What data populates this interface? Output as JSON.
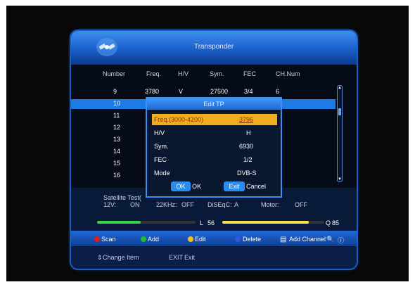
{
  "header": {
    "title": "Transponder"
  },
  "columns": [
    "Number",
    "Freq.",
    "H/V",
    "Sym.",
    "FEC",
    "CH.Num"
  ],
  "rows": [
    {
      "number": "9",
      "freq": "3780",
      "hv": "V",
      "sym": "27500",
      "fec": "3/4",
      "chnum": "6"
    },
    {
      "number": "10"
    },
    {
      "number": "11"
    },
    {
      "number": "12"
    },
    {
      "number": "13"
    },
    {
      "number": "14"
    },
    {
      "number": "15"
    },
    {
      "number": "16"
    }
  ],
  "selected_row": 1,
  "info": {
    "satellite": "Satellite Test(",
    "v12_label": "12V:",
    "v12_value": "ON",
    "k22_label": "22KHz:",
    "k22_value": "OFF",
    "diseqc_label": "DiSEqC:",
    "diseqc_value": "A",
    "motor_label": "Motor:",
    "motor_value": "OFF"
  },
  "signal": {
    "level_label": "L",
    "level_value": "56",
    "quality_label": "Q",
    "quality_value": "85",
    "level_percent": 56,
    "quality_percent": 85
  },
  "dialog": {
    "title": "Edit TP",
    "fields": [
      {
        "label": "Freq.(3000-4200)",
        "value": "3796"
      },
      {
        "label": "H/V",
        "value": "H"
      },
      {
        "label": "Sym.",
        "value": "6930"
      },
      {
        "label": "FEC",
        "value": "1/2"
      },
      {
        "label": "Mode",
        "value": "DVB-S"
      }
    ],
    "ok_button": "OK",
    "ok_label": "OK",
    "exit_button": "Exit",
    "cancel_label": "Cancel"
  },
  "bottom": {
    "scan": "Scan",
    "add": "Add",
    "edit": "Edit",
    "delete": "Delete",
    "add_channel": "Add Channel"
  },
  "footer": {
    "change_item": "Change Item",
    "exit_key": "EXIT",
    "exit_label": "Exit"
  },
  "colors": {
    "red": "#e21b1b",
    "green": "#1fbf2a",
    "yellow": "#f2c21b",
    "blue": "#2f58e0",
    "highlight": "#f0ad20",
    "selected_row": "#1d7be6"
  }
}
